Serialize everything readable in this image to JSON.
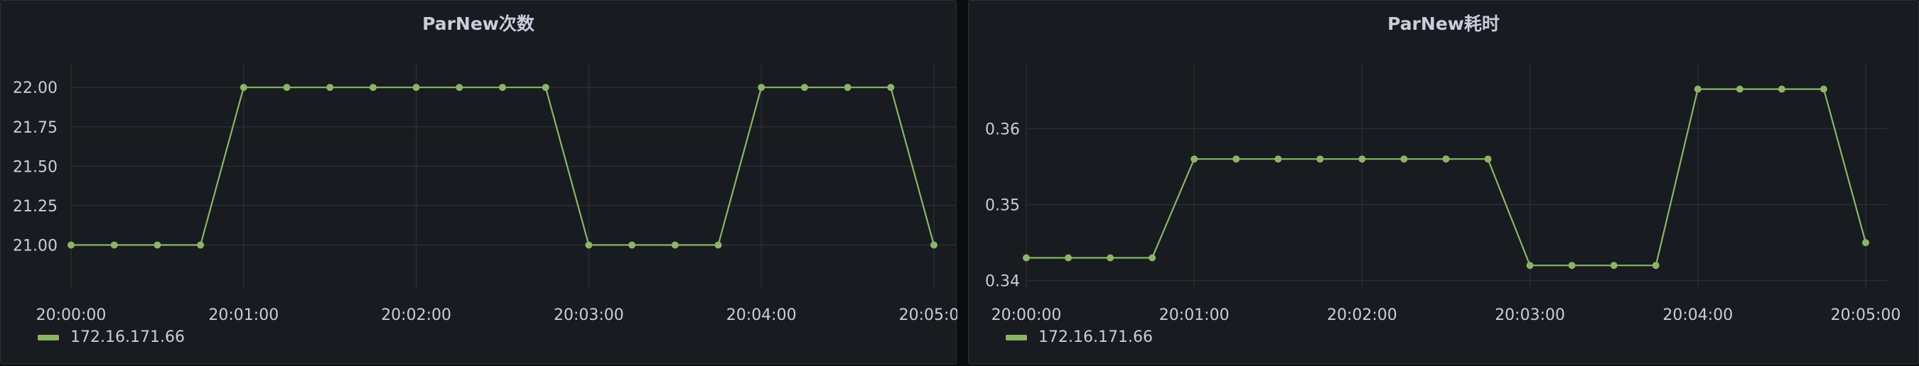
{
  "colors": {
    "series": "#8ab568"
  },
  "chart_data": [
    {
      "type": "line",
      "title": "ParNew次数",
      "xlabel": "",
      "ylabel": "",
      "x": [
        "20:00:00",
        "20:00:15",
        "20:00:30",
        "20:00:45",
        "20:01:00",
        "20:01:15",
        "20:01:30",
        "20:01:45",
        "20:02:00",
        "20:02:15",
        "20:02:30",
        "20:02:45",
        "20:03:00",
        "20:03:15",
        "20:03:30",
        "20:03:45",
        "20:04:00",
        "20:04:15",
        "20:04:30",
        "20:04:45",
        "20:05:00"
      ],
      "x_ticks": [
        "20:00:00",
        "20:01:00",
        "20:02:00",
        "20:03:00",
        "20:04:00",
        "20:05:00"
      ],
      "y_ticks": [
        "21.00",
        "21.25",
        "21.50",
        "21.75",
        "22.00"
      ],
      "ylim": [
        20.75,
        22.1
      ],
      "grid": true,
      "legend_position": "bottom-left",
      "series": [
        {
          "name": "172.16.171.66",
          "values": [
            21,
            21,
            21,
            21,
            22,
            22,
            22,
            22,
            22,
            22,
            22,
            22,
            21,
            21,
            21,
            21,
            22,
            22,
            22,
            22,
            21
          ]
        }
      ]
    },
    {
      "type": "line",
      "title": "ParNew耗时",
      "xlabel": "",
      "ylabel": "",
      "x": [
        "20:00:00",
        "20:00:15",
        "20:00:30",
        "20:00:45",
        "20:01:00",
        "20:01:15",
        "20:01:30",
        "20:01:45",
        "20:02:00",
        "20:02:15",
        "20:02:30",
        "20:02:45",
        "20:03:00",
        "20:03:15",
        "20:03:30",
        "20:03:45",
        "20:04:00",
        "20:04:15",
        "20:04:30",
        "20:04:45",
        "20:05:00"
      ],
      "x_ticks": [
        "20:00:00",
        "20:01:00",
        "20:02:00",
        "20:03:00",
        "20:04:00",
        "20:05:00"
      ],
      "y_ticks": [
        "0.34",
        "0.35",
        "0.36"
      ],
      "ylim": [
        0.3395,
        0.3675
      ],
      "grid": true,
      "legend_position": "bottom-left",
      "series": [
        {
          "name": "172.16.171.66",
          "values": [
            0.343,
            0.343,
            0.343,
            0.343,
            0.356,
            0.356,
            0.356,
            0.356,
            0.356,
            0.356,
            0.356,
            0.356,
            0.342,
            0.342,
            0.342,
            0.342,
            0.3652,
            0.3652,
            0.3652,
            0.3652,
            0.345
          ]
        }
      ]
    }
  ]
}
